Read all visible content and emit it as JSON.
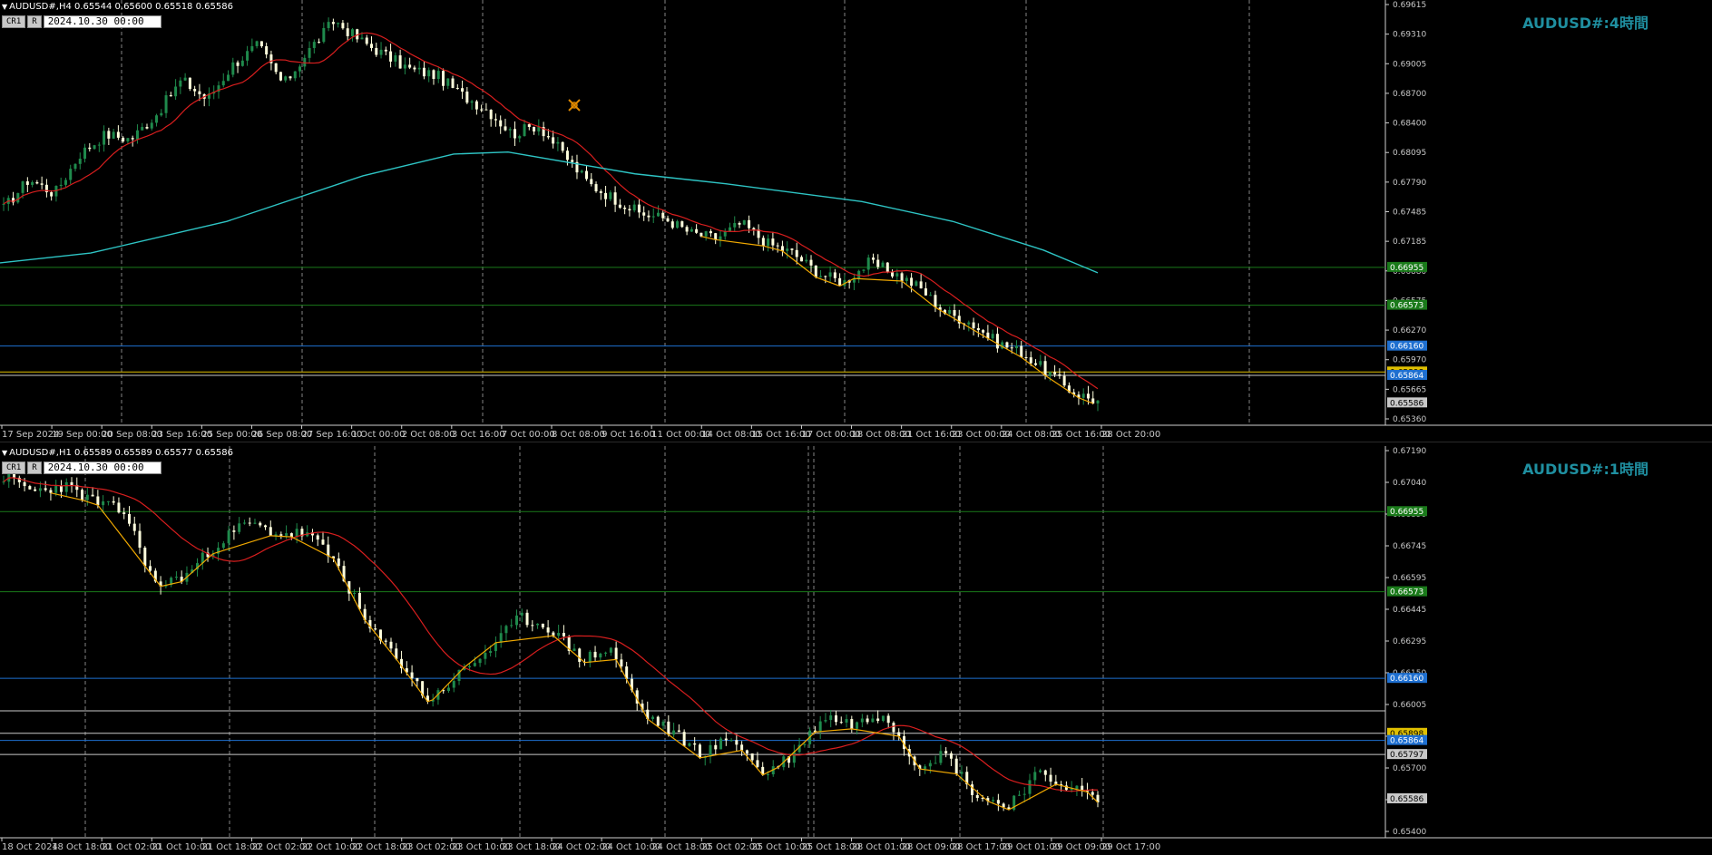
{
  "h4": {
    "header": "AUDUSD#,H4  0.65544 0.65600 0.65518 0.65586",
    "buttons": [
      "CR1",
      "R"
    ],
    "datetime": "2024.10.30 00:00",
    "title": "AUDUSD#:4時間",
    "price_labels": [
      "0.69615",
      "0.69310",
      "0.69005",
      "0.68700",
      "0.68400",
      "0.68095",
      "0.67790",
      "0.67485",
      "0.67185",
      "0.66880",
      "0.66575",
      "0.66270",
      "0.65970",
      "0.65665",
      "0.65360"
    ],
    "level_tags": [
      {
        "text": "0.66955",
        "color": "#1a7a1a"
      },
      {
        "text": "0.66573",
        "color": "#1a7a1a"
      },
      {
        "text": "0.66160",
        "color": "#1e6fd0"
      },
      {
        "text": "0.65898",
        "color": "#e0c000"
      },
      {
        "text": "0.65864",
        "color": "#1e6fd0"
      },
      {
        "text": "0.65586",
        "color": "#c8c8c8"
      }
    ],
    "time_labels": [
      "17 Sep 2024",
      "19 Sep 00:00",
      "20 Sep 08:00",
      "23 Sep 16:00",
      "25 Sep 00:00",
      "26 Sep 08:00",
      "27 Sep 16:00",
      "1 Oct 00:00",
      "2 Oct 08:00",
      "3 Oct 16:00",
      "7 Oct 00:00",
      "8 Oct 08:00",
      "9 Oct 16:00",
      "11 Oct 00:00",
      "14 Oct 08:00",
      "15 Oct 16:00",
      "17 Oct 00:00",
      "18 Oct 08:00",
      "21 Oct 16:00",
      "23 Oct 00:00",
      "24 Oct 08:00",
      "25 Oct 16:00",
      "28 Oct 20:00"
    ]
  },
  "h1": {
    "header": "AUDUSD#,H1  0.65589 0.65589 0.65577 0.65586",
    "buttons": [
      "CR1",
      "R"
    ],
    "datetime": "2024.10.30 00:00",
    "title": "AUDUSD#:1時間",
    "price_labels": [
      "0.67190",
      "0.67040",
      "0.66890",
      "0.66745",
      "0.66595",
      "0.66445",
      "0.66295",
      "0.66150",
      "0.66005",
      "0.65850",
      "0.65700",
      "0.65550",
      "0.65400"
    ],
    "level_tags": [
      {
        "text": "0.66955",
        "color": "#1a7a1a"
      },
      {
        "text": "0.66573",
        "color": "#1a7a1a"
      },
      {
        "text": "0.66160",
        "color": "#1e6fd0"
      },
      {
        "text": "0.65898",
        "color": "#e0c000"
      },
      {
        "text": "0.65864",
        "color": "#1e6fd0"
      },
      {
        "text": "0.65797",
        "color": "#c8c8c8"
      },
      {
        "text": "0.65586",
        "color": "#c8c8c8"
      }
    ],
    "time_labels": [
      "18 Oct 2024",
      "18 Oct 18:00",
      "21 Oct 02:00",
      "21 Oct 10:00",
      "21 Oct 18:00",
      "22 Oct 02:00",
      "22 Oct 10:00",
      "22 Oct 18:00",
      "23 Oct 02:00",
      "23 Oct 10:00",
      "23 Oct 18:00",
      "24 Oct 02:00",
      "24 Oct 10:00",
      "24 Oct 18:00",
      "25 Oct 02:00",
      "25 Oct 10:00",
      "25 Oct 18:00",
      "28 Oct 01:00",
      "28 Oct 09:00",
      "28 Oct 17:00",
      "29 Oct 01:00",
      "29 Oct 09:00",
      "29 Oct 17:00"
    ]
  },
  "colors": {
    "bull": "#1f8a4c",
    "bear": "#ffffdd",
    "ma_fast": "#d81e1e",
    "ma_slow": "#2ec4c4",
    "zigzag": "#f0a800",
    "grid_v": "#cfcfcf",
    "level_green": "#1a7a1a",
    "level_blue": "#1e6fd0",
    "level_yellow": "#e0c000",
    "level_white": "#c8c8c8"
  },
  "chart_data": [
    {
      "type": "candlestick",
      "title": "AUDUSD#:4時間",
      "timeframe": "H4",
      "ylim": [
        0.6536,
        0.6962
      ],
      "close_path": [
        0.6755,
        0.6785,
        0.677,
        0.681,
        0.683,
        0.6825,
        0.685,
        0.6885,
        0.6865,
        0.69,
        0.692,
        0.688,
        0.6915,
        0.6945,
        0.6925,
        0.691,
        0.6895,
        0.689,
        0.687,
        0.6855,
        0.683,
        0.684,
        0.681,
        0.678,
        0.6765,
        0.675,
        0.6745,
        0.673,
        0.6725,
        0.674,
        0.672,
        0.671,
        0.669,
        0.668,
        0.67,
        0.669,
        0.6675,
        0.665,
        0.664,
        0.662,
        0.661,
        0.659,
        0.657,
        0.656
      ]
    },
    {
      "type": "candlestick",
      "title": "AUDUSD#:1時間",
      "timeframe": "H1",
      "ylim": [
        0.654,
        0.6725
      ],
      "close_path": [
        0.6712,
        0.6705,
        0.6708,
        0.67,
        0.6695,
        0.666,
        0.6665,
        0.668,
        0.669,
        0.6685,
        0.6685,
        0.667,
        0.664,
        0.6625,
        0.6605,
        0.6618,
        0.663,
        0.6645,
        0.664,
        0.6625,
        0.663,
        0.66,
        0.659,
        0.658,
        0.6588,
        0.657,
        0.658,
        0.6598,
        0.6594,
        0.66,
        0.6575,
        0.658,
        0.656,
        0.6555,
        0.657,
        0.6565,
        0.6558
      ]
    }
  ]
}
